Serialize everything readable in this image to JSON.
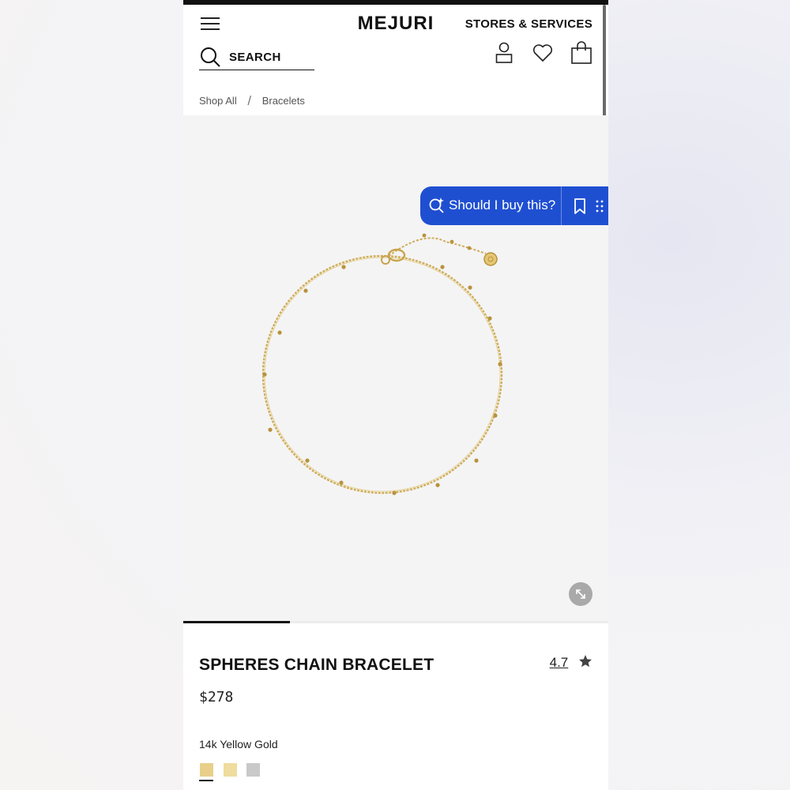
{
  "header": {
    "logo": "MEJURI",
    "stores_link": "STORES & SERVICES",
    "search_label": "SEARCH",
    "icons": [
      "menu-icon",
      "search-icon",
      "account-icon",
      "heart-icon",
      "bag-icon"
    ]
  },
  "breadcrumb": {
    "items": [
      "Shop All",
      "Bracelets"
    ],
    "separator": "/"
  },
  "assistant": {
    "label": "Should I buy this?",
    "icons": [
      "search-sparkle-icon",
      "bookmark-icon",
      "drag-handle-icon"
    ],
    "color": "#1f4fd1"
  },
  "gallery": {
    "image": "gold spheres chain bracelet",
    "expand_icon": "expand-icon",
    "progress_fraction": 0.25
  },
  "product": {
    "name": "SPHERES CHAIN BRACELET",
    "rating": "4.7",
    "rating_icon": "star-icon",
    "price": "$278",
    "material": "14k Yellow Gold",
    "swatches": [
      {
        "name": "yellow-gold",
        "color": "#e8d08a",
        "selected": true
      },
      {
        "name": "light-gold",
        "color": "#efdc9e",
        "selected": false
      },
      {
        "name": "silver",
        "color": "#c9c9c9",
        "selected": false
      }
    ]
  }
}
